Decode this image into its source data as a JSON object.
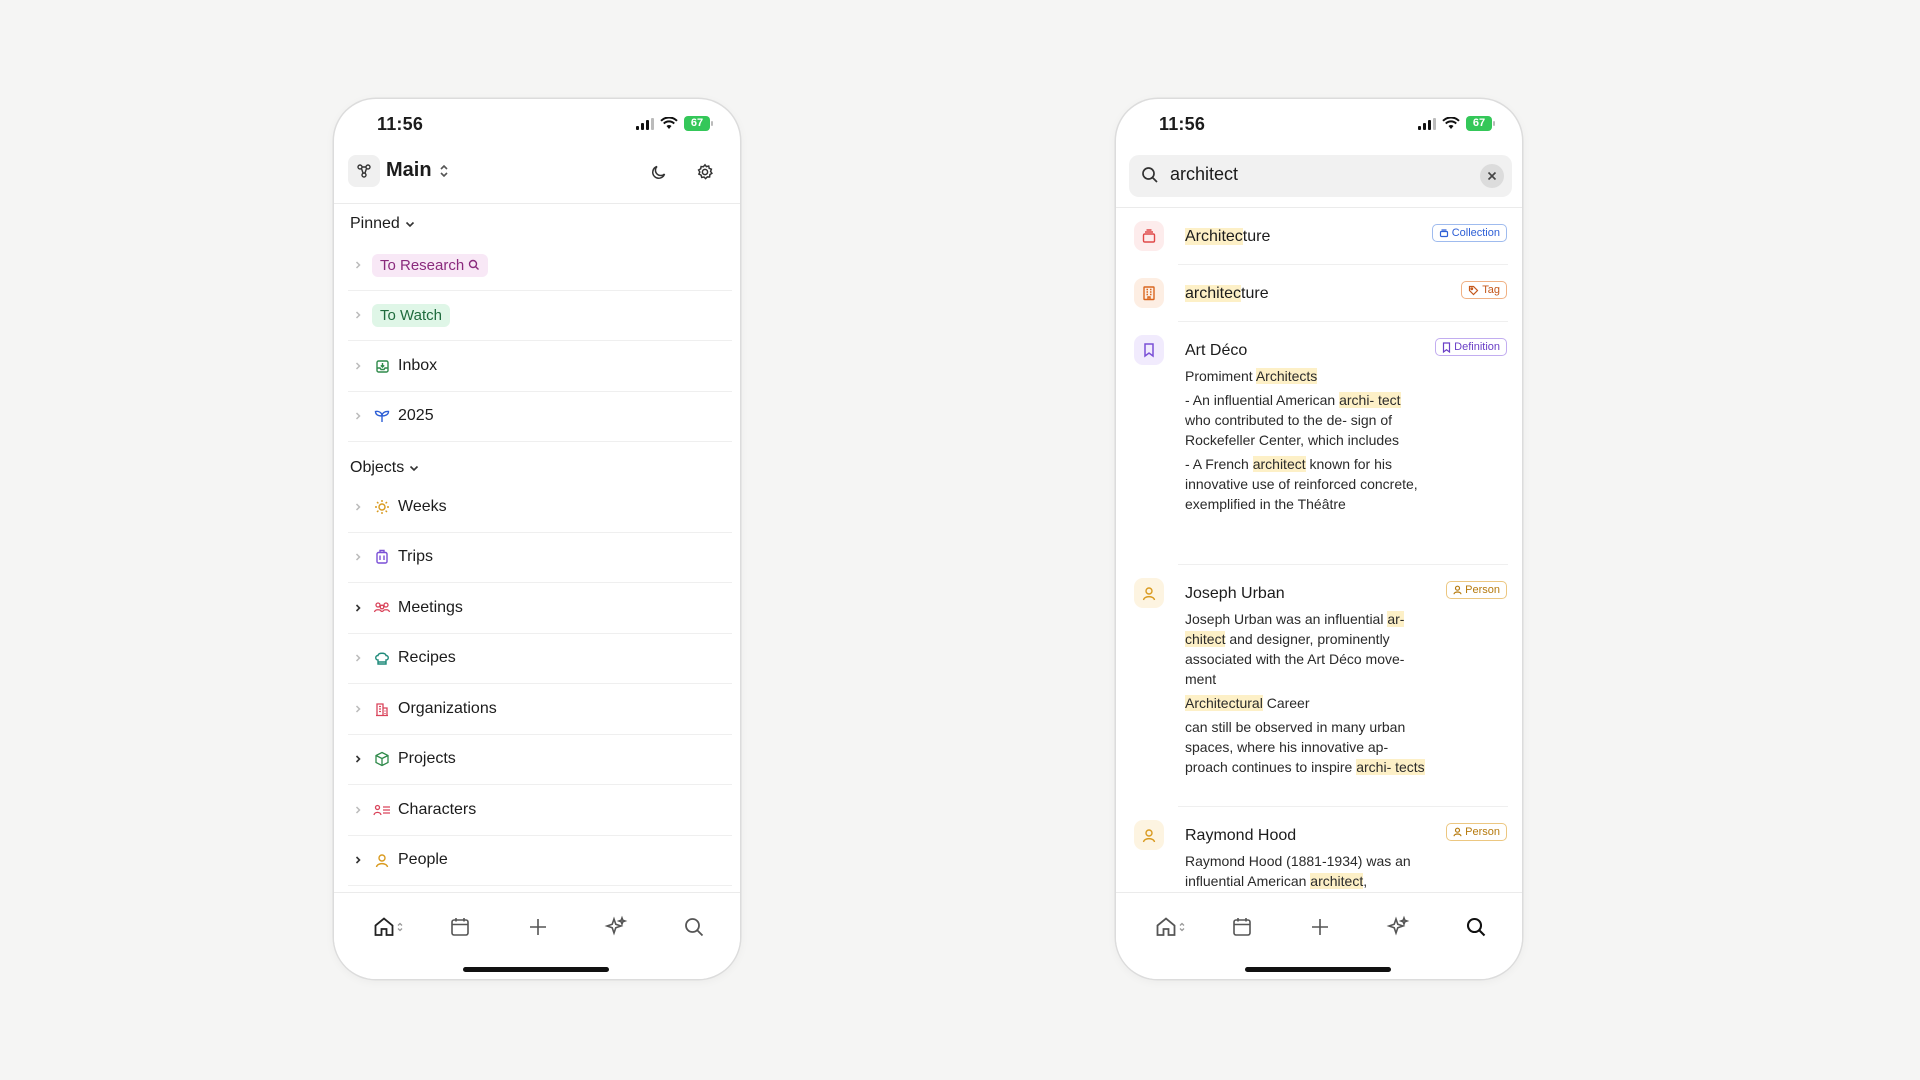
{
  "left_phone": {
    "status": {
      "time": "11:56",
      "battery": "67"
    },
    "header": {
      "space_name": "Main"
    },
    "pinned": {
      "title": "Pinned",
      "items": [
        {
          "label": "To Research"
        },
        {
          "label": "To Watch"
        },
        {
          "label": "Inbox"
        },
        {
          "label": "2025"
        }
      ]
    },
    "objects": {
      "title": "Objects",
      "items": [
        {
          "label": "Weeks"
        },
        {
          "label": "Trips"
        },
        {
          "label": "Meetings"
        },
        {
          "label": "Recipes"
        },
        {
          "label": "Organizations"
        },
        {
          "label": "Projects"
        },
        {
          "label": "Characters"
        },
        {
          "label": "People"
        }
      ]
    }
  },
  "right_phone": {
    "status": {
      "time": "11:56",
      "battery": "67"
    },
    "search": {
      "query": "architect"
    },
    "results": [
      {
        "title_hl": "Architec",
        "title_rest": "ture",
        "badge": "Collection"
      },
      {
        "title_hl": "architec",
        "title_rest": "ture",
        "badge": "Tag"
      },
      {
        "title": "Art Déco",
        "badge": "Definition",
        "line1_pre": "Promiment ",
        "line1_hl": "Architects",
        "p2_pre": "- An influential American ",
        "p2_hl": "archi- tect",
        "p2_post": " who contributed to the de- sign of Rockefeller Center, which includes",
        "p3_pre": "- A French ",
        "p3_hl": "architect",
        "p3_post": " known for his innovative use of reinforced concrete, exemplified in the Théâtre"
      },
      {
        "title": "Joseph Urban",
        "badge": "Person",
        "p1_pre": "Joseph Urban was an influential ",
        "p1_hl": "ar- chitect",
        "p1_post": " and designer, prominently associated with the Art Déco move- ment",
        "p2_hl": "Architectural",
        "p2_post": " Career",
        "p3_pre": "can still be observed in many urban spaces, where his innovative ap- proach continues to inspire ",
        "p3_hl": "archi- tects"
      },
      {
        "title": "Raymond Hood",
        "badge": "Person",
        "p1_pre": "Raymond Hood (1881-1934) was an influential American ",
        "p1_hl": "architect",
        "p1_post": ","
      }
    ]
  },
  "colors": {
    "collection": "#e04848",
    "tag": "#d9661f",
    "definition": "#7a4fd6",
    "person": "#d99a1f",
    "highlight": "#fdf0c7"
  }
}
